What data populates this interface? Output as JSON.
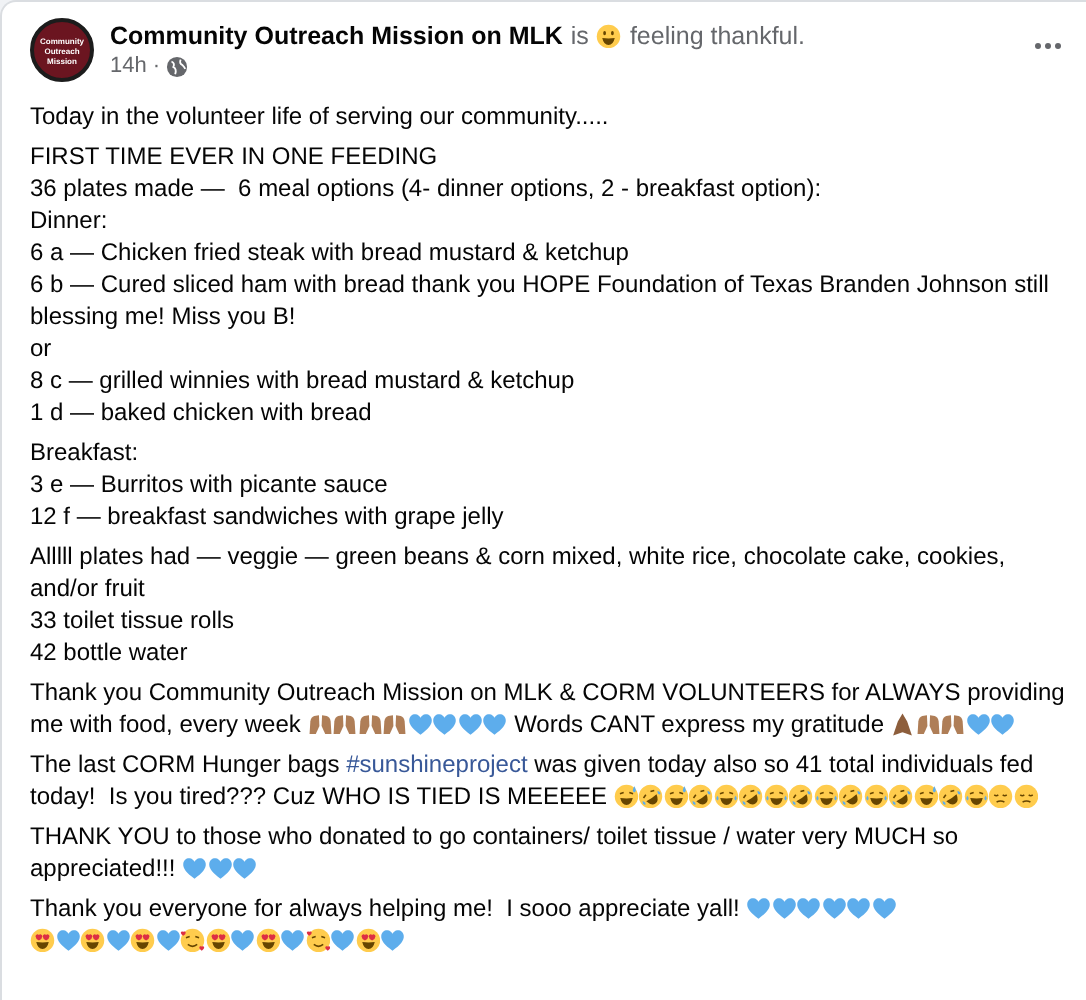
{
  "post": {
    "avatar_text": "Community Outreach Mission",
    "author": "Community Outreach Mission on MLK",
    "activity_prefix": "is",
    "activity": "feeling thankful.",
    "time": "14h",
    "separator": "·"
  },
  "paragraphs": [
    {
      "lines": [
        "Today in the volunteer life of serving our community....."
      ]
    },
    {
      "lines": [
        "FIRST TIME EVER IN ONE FEEDING",
        "36 plates made —  6 meal options (4- dinner options, 2 - breakfast option):",
        "Dinner:",
        "6 a — Chicken fried steak with bread mustard & ketchup",
        "6 b — Cured sliced ham with bread thank you HOPE Foundation of Texas Branden Johnson still",
        "blessing me! Miss you B!",
        "or",
        "8 c — grilled winnies with bread mustard & ketchup",
        "1 d — baked chicken with bread"
      ]
    },
    {
      "lines": [
        "Breakfast:",
        "3 e — Burritos with picante sauce",
        "12 f — breakfast sandwiches with grape jelly"
      ]
    },
    {
      "lines": [
        "Alllll plates had — veggie — green beans & corn mixed, white rice, chocolate cake, cookies,",
        "and/or fruit",
        "33 toilet tissue rolls",
        "42 bottle water"
      ]
    },
    {
      "lines": [
        "Thank you Community Outreach Mission on MLK & CORM VOLUNTEERS for ALWAYS providing",
        [
          {
            "kind": "text",
            "text": "me with food, every week "
          },
          {
            "kind": "raised-hands"
          },
          {
            "kind": "raised-hands"
          },
          {
            "kind": "raised-hands"
          },
          {
            "kind": "raised-hands"
          },
          {
            "kind": "heart"
          },
          {
            "kind": "heart"
          },
          {
            "kind": "heart"
          },
          {
            "kind": "heart"
          },
          {
            "kind": "text",
            "text": " Words CANT express my gratitude "
          },
          {
            "kind": "praying-hands"
          },
          {
            "kind": "raised-hands"
          },
          {
            "kind": "raised-hands"
          },
          {
            "kind": "heart"
          },
          {
            "kind": "heart"
          }
        ]
      ]
    },
    {
      "lines": [
        [
          {
            "kind": "text",
            "text": "The last CORM Hunger bags "
          },
          {
            "kind": "hashtag",
            "text": "#sunshineproject"
          },
          {
            "kind": "text",
            "text": " was given today also so 41 total individuals fed"
          }
        ],
        [
          {
            "kind": "text",
            "text": "today!  Is you tired??? Cuz WHO IS TIED IS MEEEEE "
          },
          {
            "kind": "sweat-smile"
          },
          {
            "kind": "rofl"
          },
          {
            "kind": "sweat-smile"
          },
          {
            "kind": "rofl"
          },
          {
            "kind": "joy"
          },
          {
            "kind": "rofl"
          },
          {
            "kind": "joy"
          },
          {
            "kind": "rofl"
          },
          {
            "kind": "joy"
          },
          {
            "kind": "rofl"
          },
          {
            "kind": "joy"
          },
          {
            "kind": "rofl"
          },
          {
            "kind": "sweat-smile"
          },
          {
            "kind": "rofl"
          },
          {
            "kind": "joy"
          },
          {
            "kind": "pensive"
          },
          {
            "kind": "pensive"
          }
        ]
      ]
    },
    {
      "lines": [
        "THANK YOU to those who donated to go containers/ toilet tissue / water very MUCH so",
        [
          {
            "kind": "text",
            "text": "appreciated!!! "
          },
          {
            "kind": "heart"
          },
          {
            "kind": "heart"
          },
          {
            "kind": "heart"
          }
        ]
      ]
    },
    {
      "lines": [
        [
          {
            "kind": "text",
            "text": "Thank you everyone for always helping me!  I sooo appreciate yall! "
          },
          {
            "kind": "heart"
          },
          {
            "kind": "heart"
          },
          {
            "kind": "heart"
          },
          {
            "kind": "heart"
          },
          {
            "kind": "heart"
          },
          {
            "kind": "heart"
          }
        ],
        [
          {
            "kind": "heart-eyes"
          },
          {
            "kind": "heart"
          },
          {
            "kind": "heart-eyes"
          },
          {
            "kind": "heart"
          },
          {
            "kind": "heart-eyes"
          },
          {
            "kind": "heart"
          },
          {
            "kind": "smiling-hearts"
          },
          {
            "kind": "heart-eyes"
          },
          {
            "kind": "heart"
          },
          {
            "kind": "heart-eyes"
          },
          {
            "kind": "heart"
          },
          {
            "kind": "smiling-hearts"
          },
          {
            "kind": "heart"
          },
          {
            "kind": "heart-eyes"
          },
          {
            "kind": "heart"
          }
        ]
      ]
    }
  ]
}
